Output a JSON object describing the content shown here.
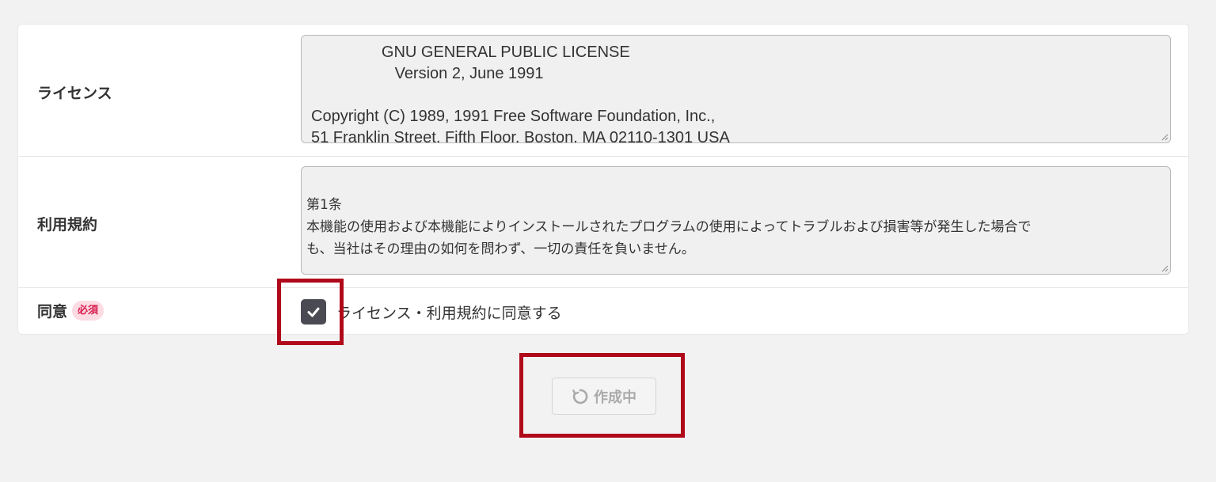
{
  "form": {
    "license": {
      "label": "ライセンス",
      "text_lines": [
        "                GNU GENERAL PUBLIC LICENSE",
        "                   Version 2, June 1991",
        "",
        "Copyright (C) 1989, 1991 Free Software Foundation, Inc.,",
        "51 Franklin Street, Fifth Floor, Boston, MA 02110-1301 USA"
      ]
    },
    "terms": {
      "label": "利用規約",
      "text_lines": [
        "第1条",
        " 本機能の使用および本機能によりインストールされたプログラムの使用によってトラブルおよび損害等が発生した場合で",
        "も、当社はその理由の如何を問わず、一切の責任を負いません。"
      ]
    },
    "consent": {
      "label": "同意",
      "required_badge": "必須",
      "checkbox_label": "ライセンス・利用規約に同意する",
      "checked": true
    }
  },
  "submit_button": {
    "label": "作成中",
    "state": "loading",
    "icon": "spinner-icon"
  },
  "colors": {
    "highlight": "#b0091a",
    "required_badge_bg": "#fcdbe3",
    "required_badge_text": "#d7194b",
    "checkbox_fill": "#4a4a52"
  }
}
